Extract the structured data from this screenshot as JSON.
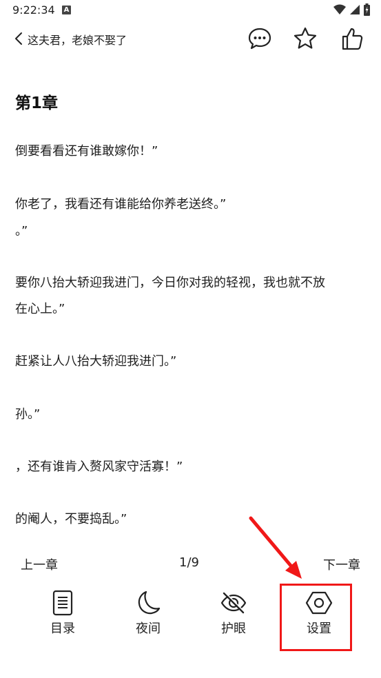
{
  "status_bar": {
    "time": "9:22:34",
    "notif_letter": "A"
  },
  "header": {
    "title": "这夫君，老娘不娶了"
  },
  "content": {
    "chapter_title": "第1章",
    "paragraphs": [
      "倒要看看还有谁敢嫁你！”",
      "你老了，我看还有谁能给你养老送终。”",
      "。”",
      "要你八抬大轿迎我进门，今日你对我的轻视，我也就不放",
      "在心上。”",
      "赶紧让人八抬大轿迎我进门。”",
      "孙。”",
      "，还有谁肯入赘风家守活寡！”",
      "的阉人，不要捣乱。”"
    ]
  },
  "chapter_nav": {
    "prev": "上一章",
    "page": "1/9",
    "next": "下一章"
  },
  "toolbar": {
    "items": [
      {
        "label": "目录",
        "icon": "document-icon"
      },
      {
        "label": "夜间",
        "icon": "moon-icon"
      },
      {
        "label": "护眼",
        "icon": "eye-off-icon"
      },
      {
        "label": "设置",
        "icon": "hexagon-settings-icon"
      }
    ]
  },
  "colors": {
    "highlight": "#f01818",
    "text": "#1f1f1f"
  }
}
